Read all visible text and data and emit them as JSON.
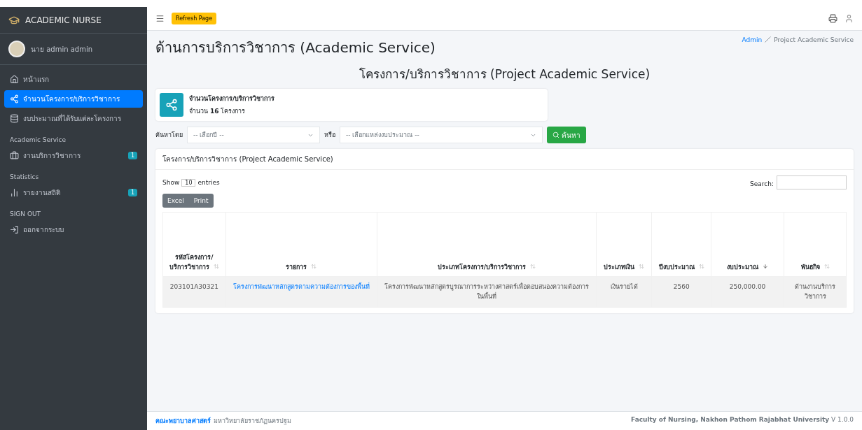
{
  "brand": {
    "title": "ACADEMIC NURSE"
  },
  "user": {
    "name": "นาย admin admin"
  },
  "sidebar": {
    "items": [
      {
        "kind": "link",
        "label": "หน้าแรก",
        "selected": false
      },
      {
        "kind": "link",
        "label": "จำนวนโครงการ/บริการวิชาการ",
        "selected": true
      },
      {
        "kind": "link",
        "label": "งบประมาณที่ได้รับแต่ละโครงการ",
        "selected": false
      },
      {
        "kind": "header",
        "label": "Academic Service"
      },
      {
        "kind": "link",
        "label": "งานบริการวิชาการ",
        "selected": false,
        "badge": "1"
      },
      {
        "kind": "header",
        "label": "Statistics"
      },
      {
        "kind": "link",
        "label": "รายงานสถิติ",
        "selected": false,
        "badge": "1"
      },
      {
        "kind": "header",
        "label": "SIGN OUT"
      },
      {
        "kind": "link",
        "label": "ออกจากระบบ",
        "selected": false
      }
    ]
  },
  "topbar": {
    "refresh_button": "Refresh Page"
  },
  "page": {
    "title": "ด้านการบริการวิชาการ (Academic Service)",
    "breadcrumb": [
      "Admin",
      "Project Academic Service"
    ],
    "subtitle": "โครงการ/บริการวิชาการ (Project Academic Service)"
  },
  "info_box": {
    "title": "จำนวนโครงการ/บริการวิชาการ",
    "text": "จำนวน **16** โครงการ"
  },
  "filters": {
    "label": "ค้นหาโดย",
    "year_select": "-- เลือกปี --",
    "or_label": "หรือ",
    "source_select": "-- เลือกแหล่งงบประมาณ --",
    "search_button": "ค้นหา"
  },
  "card": {
    "title": "โครงการ/บริการวิชาการ (Project Academic Service)",
    "show_label": "Show",
    "entries_value": "10",
    "entries_label": "entries",
    "search_label": "Search:",
    "export_buttons": [
      "Excel",
      "Print"
    ]
  },
  "table": {
    "columns": [
      {
        "label": "รหัสโครงการ/บริการวิชาการ",
        "sorted": false
      },
      {
        "label": "รายการ",
        "sorted": false
      },
      {
        "label": "ประเภทโครงการ/บริการวิชาการ",
        "sorted": false
      },
      {
        "label": "ประเภทเงิน",
        "sorted": false
      },
      {
        "label": "ปีงบประมาณ",
        "sorted": false
      },
      {
        "label": "งบประมาณ",
        "sorted": true
      },
      {
        "label": "พันธกิจ",
        "sorted": false
      }
    ],
    "rows": [
      [
        "203101A30321",
        "โครงการพัฒนาหลักสูตรตามความต้องการของพื้นที่",
        "โครงการพัฒนาหลักสูตรบูรณาการระหว่างศาสตร์เพื่อตอบสนองความต้องการในพื้นที่",
        "เงินรายได้",
        "2560",
        "250,000.00",
        "ด้านงานบริการวิชาการ"
      ]
    ]
  },
  "footer": {
    "link": "คณะพยาบาลศาสตร์",
    "text": "มหาวิทยาลัยราชภัฏนครปฐม",
    "right": "Faculty of Nursing, Nakhon Pathom Rajabhat University",
    "version": "V 1.0.0"
  }
}
